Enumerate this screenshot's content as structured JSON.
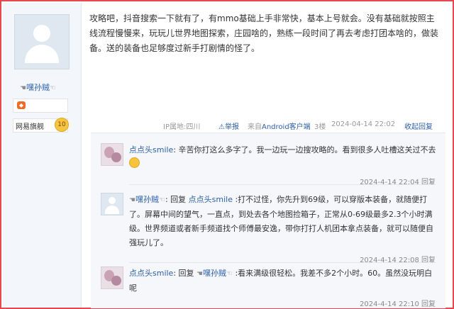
{
  "user": {
    "name": "嘿孙贼",
    "badge_label": "网易旗舰",
    "badge_level": "10"
  },
  "post": {
    "content": "攻略吧，抖音搜索一下就有了，有mmo基础上手非常快，基本上号就会。没有基础就按照主线流程慢慢来，玩玩儿世界地图探索，庄园啥的，熟练一段时间了再去考虑打团本啥的，做装备。送的装备也足够度过新手打剧情的怪了。",
    "ip": "IP属地:四川",
    "report": "举报",
    "source_prefix": "来自",
    "source_link": "Android客户端",
    "floor": "3楼",
    "time": "2024-04-14 22:02",
    "collapse": "收起回复"
  },
  "replies": [
    {
      "name": "点点头smile",
      "sep": ": ",
      "text": "辛苦你打这么多字了。我一边玩一边搜攻略的。看到很多人吐槽这关过不去",
      "time": "2024-4-14 22:04",
      "reply_btn": "回复"
    },
    {
      "name": "嘿孙贼",
      "prefix": ": 回复 ",
      "target": "点点头smile",
      "text": " :打不过怪，你先升到69级，可以穿版本装备，就随便打了。屏幕中间的望气，一直点，到处去各个地图捡箱子，正常从0-69级最多2.3个小时满级。世界频道或者新手频道找个师傅最安逸，带你打打人机团本拿点装备，就可以随便自强玩儿了。",
      "time": "2024-4-14 22:08",
      "reply_btn": "回复"
    },
    {
      "name": "点点头smile",
      "prefix": ": 回复 ",
      "target": "嘿孙贼",
      "text": " :看来满级很轻松。我差不多2个小时。60。虽然没玩明白呢",
      "time": "2024-4-14 22:10",
      "reply_btn": "回复"
    }
  ]
}
